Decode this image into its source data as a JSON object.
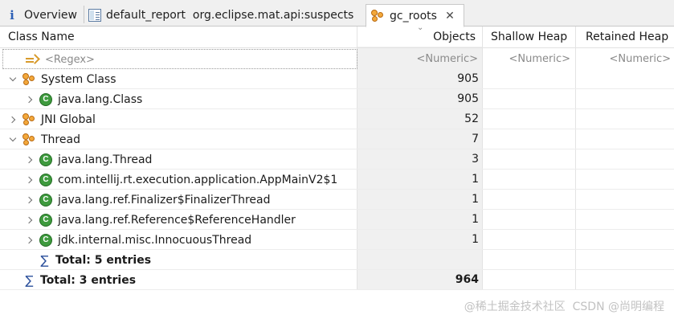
{
  "tabs": [
    {
      "label": "Overview",
      "icon": "info-icon"
    },
    {
      "label": "default_report  org.eclipse.mat.api:suspects",
      "icon": "report-icon"
    },
    {
      "label": "gc_roots",
      "icon": "gc-roots-icon",
      "active": true
    }
  ],
  "table": {
    "columns": {
      "class_name": "Class Name",
      "objects": "Objects",
      "shallow_heap": "Shallow Heap",
      "retained_heap": "Retained Heap"
    },
    "filter": {
      "regex_placeholder": "<Regex>",
      "objects_placeholder": "<Numeric>",
      "shallow_placeholder": "<Numeric>",
      "retained_placeholder": "<Numeric>"
    },
    "rows": [
      {
        "name": "System Class",
        "objects": "905"
      },
      {
        "name": "java.lang.Class",
        "objects": "905"
      },
      {
        "name": "JNI Global",
        "objects": "52"
      },
      {
        "name": "Thread",
        "objects": "7"
      },
      {
        "name": "java.lang.Thread",
        "objects": "3"
      },
      {
        "name": "com.intellij.rt.execution.application.AppMainV2$1",
        "objects": "1"
      },
      {
        "name": "java.lang.ref.Finalizer$FinalizerThread",
        "objects": "1"
      },
      {
        "name": "java.lang.ref.Reference$ReferenceHandler",
        "objects": "1"
      },
      {
        "name": "jdk.internal.misc.InnocuousThread",
        "objects": "1"
      },
      {
        "name": "Total: 5 entries",
        "objects": ""
      },
      {
        "name": "Total: 3 entries",
        "objects": "964"
      }
    ]
  },
  "watermark": "@稀土掘金技术社区  CSDN @尚明编程",
  "colors": {
    "accent_class_icon": "#3e9a3e",
    "group_icon": "#f3a83b",
    "sigma": "#2b4f9b"
  }
}
